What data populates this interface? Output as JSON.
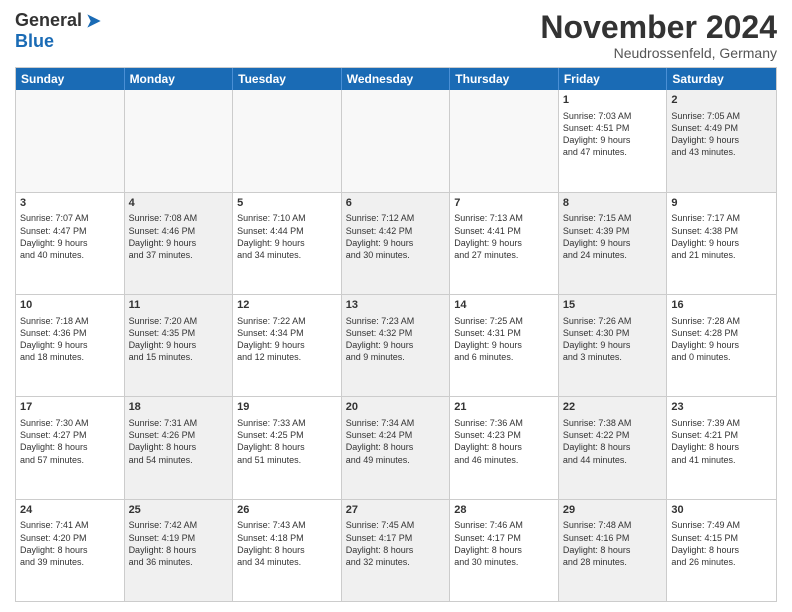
{
  "header": {
    "logo_general": "General",
    "logo_blue": "Blue",
    "month": "November 2024",
    "location": "Neudrossenfeld, Germany"
  },
  "weekdays": [
    "Sunday",
    "Monday",
    "Tuesday",
    "Wednesday",
    "Thursday",
    "Friday",
    "Saturday"
  ],
  "rows": [
    [
      {
        "day": "",
        "text": "",
        "shaded": false,
        "empty": true
      },
      {
        "day": "",
        "text": "",
        "shaded": false,
        "empty": true
      },
      {
        "day": "",
        "text": "",
        "shaded": false,
        "empty": true
      },
      {
        "day": "",
        "text": "",
        "shaded": false,
        "empty": true
      },
      {
        "day": "",
        "text": "",
        "shaded": false,
        "empty": true
      },
      {
        "day": "1",
        "text": "Sunrise: 7:03 AM\nSunset: 4:51 PM\nDaylight: 9 hours\nand 47 minutes.",
        "shaded": false
      },
      {
        "day": "2",
        "text": "Sunrise: 7:05 AM\nSunset: 4:49 PM\nDaylight: 9 hours\nand 43 minutes.",
        "shaded": true
      }
    ],
    [
      {
        "day": "3",
        "text": "Sunrise: 7:07 AM\nSunset: 4:47 PM\nDaylight: 9 hours\nand 40 minutes.",
        "shaded": false
      },
      {
        "day": "4",
        "text": "Sunrise: 7:08 AM\nSunset: 4:46 PM\nDaylight: 9 hours\nand 37 minutes.",
        "shaded": true
      },
      {
        "day": "5",
        "text": "Sunrise: 7:10 AM\nSunset: 4:44 PM\nDaylight: 9 hours\nand 34 minutes.",
        "shaded": false
      },
      {
        "day": "6",
        "text": "Sunrise: 7:12 AM\nSunset: 4:42 PM\nDaylight: 9 hours\nand 30 minutes.",
        "shaded": true
      },
      {
        "day": "7",
        "text": "Sunrise: 7:13 AM\nSunset: 4:41 PM\nDaylight: 9 hours\nand 27 minutes.",
        "shaded": false
      },
      {
        "day": "8",
        "text": "Sunrise: 7:15 AM\nSunset: 4:39 PM\nDaylight: 9 hours\nand 24 minutes.",
        "shaded": true
      },
      {
        "day": "9",
        "text": "Sunrise: 7:17 AM\nSunset: 4:38 PM\nDaylight: 9 hours\nand 21 minutes.",
        "shaded": false
      }
    ],
    [
      {
        "day": "10",
        "text": "Sunrise: 7:18 AM\nSunset: 4:36 PM\nDaylight: 9 hours\nand 18 minutes.",
        "shaded": false
      },
      {
        "day": "11",
        "text": "Sunrise: 7:20 AM\nSunset: 4:35 PM\nDaylight: 9 hours\nand 15 minutes.",
        "shaded": true
      },
      {
        "day": "12",
        "text": "Sunrise: 7:22 AM\nSunset: 4:34 PM\nDaylight: 9 hours\nand 12 minutes.",
        "shaded": false
      },
      {
        "day": "13",
        "text": "Sunrise: 7:23 AM\nSunset: 4:32 PM\nDaylight: 9 hours\nand 9 minutes.",
        "shaded": true
      },
      {
        "day": "14",
        "text": "Sunrise: 7:25 AM\nSunset: 4:31 PM\nDaylight: 9 hours\nand 6 minutes.",
        "shaded": false
      },
      {
        "day": "15",
        "text": "Sunrise: 7:26 AM\nSunset: 4:30 PM\nDaylight: 9 hours\nand 3 minutes.",
        "shaded": true
      },
      {
        "day": "16",
        "text": "Sunrise: 7:28 AM\nSunset: 4:28 PM\nDaylight: 9 hours\nand 0 minutes.",
        "shaded": false
      }
    ],
    [
      {
        "day": "17",
        "text": "Sunrise: 7:30 AM\nSunset: 4:27 PM\nDaylight: 8 hours\nand 57 minutes.",
        "shaded": false
      },
      {
        "day": "18",
        "text": "Sunrise: 7:31 AM\nSunset: 4:26 PM\nDaylight: 8 hours\nand 54 minutes.",
        "shaded": true
      },
      {
        "day": "19",
        "text": "Sunrise: 7:33 AM\nSunset: 4:25 PM\nDaylight: 8 hours\nand 51 minutes.",
        "shaded": false
      },
      {
        "day": "20",
        "text": "Sunrise: 7:34 AM\nSunset: 4:24 PM\nDaylight: 8 hours\nand 49 minutes.",
        "shaded": true
      },
      {
        "day": "21",
        "text": "Sunrise: 7:36 AM\nSunset: 4:23 PM\nDaylight: 8 hours\nand 46 minutes.",
        "shaded": false
      },
      {
        "day": "22",
        "text": "Sunrise: 7:38 AM\nSunset: 4:22 PM\nDaylight: 8 hours\nand 44 minutes.",
        "shaded": true
      },
      {
        "day": "23",
        "text": "Sunrise: 7:39 AM\nSunset: 4:21 PM\nDaylight: 8 hours\nand 41 minutes.",
        "shaded": false
      }
    ],
    [
      {
        "day": "24",
        "text": "Sunrise: 7:41 AM\nSunset: 4:20 PM\nDaylight: 8 hours\nand 39 minutes.",
        "shaded": false
      },
      {
        "day": "25",
        "text": "Sunrise: 7:42 AM\nSunset: 4:19 PM\nDaylight: 8 hours\nand 36 minutes.",
        "shaded": true
      },
      {
        "day": "26",
        "text": "Sunrise: 7:43 AM\nSunset: 4:18 PM\nDaylight: 8 hours\nand 34 minutes.",
        "shaded": false
      },
      {
        "day": "27",
        "text": "Sunrise: 7:45 AM\nSunset: 4:17 PM\nDaylight: 8 hours\nand 32 minutes.",
        "shaded": true
      },
      {
        "day": "28",
        "text": "Sunrise: 7:46 AM\nSunset: 4:17 PM\nDaylight: 8 hours\nand 30 minutes.",
        "shaded": false
      },
      {
        "day": "29",
        "text": "Sunrise: 7:48 AM\nSunset: 4:16 PM\nDaylight: 8 hours\nand 28 minutes.",
        "shaded": true
      },
      {
        "day": "30",
        "text": "Sunrise: 7:49 AM\nSunset: 4:15 PM\nDaylight: 8 hours\nand 26 minutes.",
        "shaded": false
      }
    ]
  ]
}
